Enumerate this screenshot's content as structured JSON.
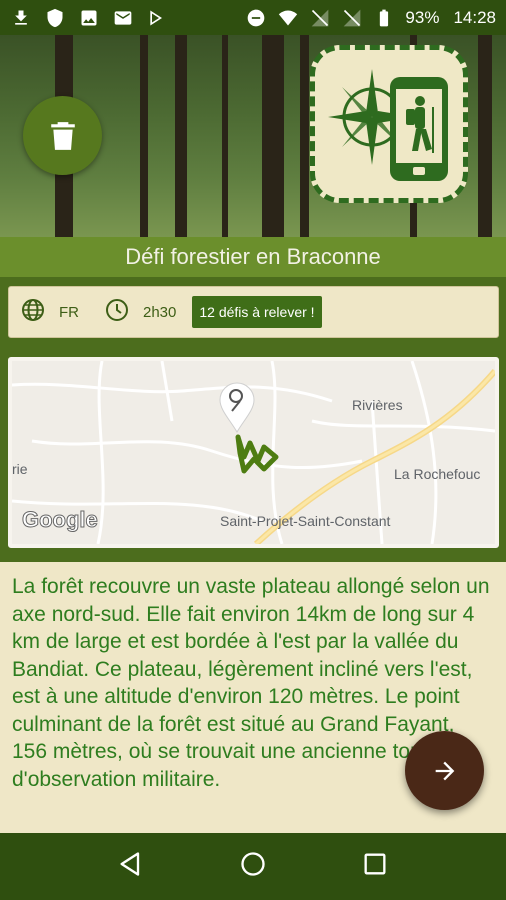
{
  "status_bar": {
    "battery": "93%",
    "time": "14:28",
    "left_icons": [
      "download-icon",
      "shield-icon",
      "image-icon",
      "mail-icon",
      "play-store-icon"
    ],
    "right_icons": [
      "do-not-disturb-icon",
      "wifi-icon",
      "signal-off-icon",
      "signal-off-icon",
      "battery-icon"
    ]
  },
  "trail": {
    "title": "Défi forestier en Braconne",
    "language": "FR",
    "duration": "2h30",
    "challenges": "12 défis à relever !"
  },
  "map": {
    "labels": [
      "Rivières",
      "La Rochefouc",
      "rie",
      "Saint-Projet-Saint-Constant"
    ],
    "attribution": "Google"
  },
  "description": "La forêt recouvre un vaste plateau allongé selon un axe nord-sud. Elle fait environ 14km de long sur 4 km de large et est bordée à l'est par la vallée du Bandiat. Ce plateau, légèrement incliné vers l'est, est à une altitude d'environ 120 mètres. Le point culminant de la forêt est situé au Grand Fayant, 156 mètres, où se trouvait une ancienne tour d'observation militaire.",
  "colors": {
    "primary": "#4c6d1d",
    "title_bar": "#6b8f2c",
    "card": "#efe7c7",
    "fab": "#4a2817",
    "text_green": "#2e7d1f"
  }
}
